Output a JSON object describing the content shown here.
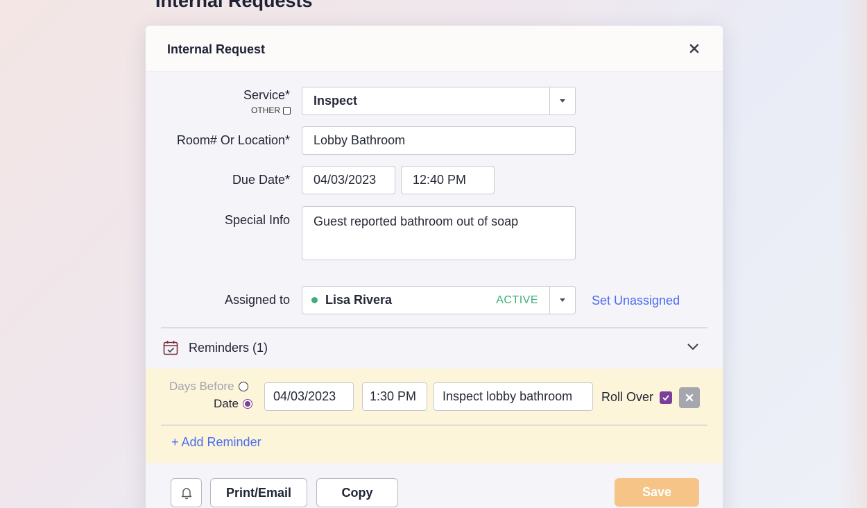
{
  "page": {
    "heading": "Internal Requests"
  },
  "modal": {
    "title": "Internal Request",
    "close_glyph": "✕"
  },
  "form": {
    "service": {
      "label": "Service*",
      "other_label": "OTHER",
      "value": "Inspect"
    },
    "location": {
      "label": "Room# Or Location*",
      "value": "Lobby Bathroom"
    },
    "due_date": {
      "label": "Due Date*",
      "date": "04/03/2023",
      "time": "12:40 PM"
    },
    "special_info": {
      "label": "Special Info",
      "value": "Guest reported bathroom out of soap"
    },
    "assigned": {
      "label": "Assigned to",
      "name": "Lisa Rivera",
      "status": "ACTIVE",
      "status_color": "#3fae7a",
      "set_unassigned": "Set Unassigned"
    }
  },
  "reminders": {
    "title": "Reminders (1)",
    "items": [
      {
        "days_before_label": "Days Before",
        "date_label": "Date",
        "mode": "Date",
        "date": "04/03/2023",
        "time": "1:30 PM",
        "text": "Inspect lobby bathroom",
        "roll_over_label": "Roll Over",
        "roll_over_checked": true
      }
    ],
    "add_label": "+ Add Reminder"
  },
  "footer": {
    "print_label": "Print/Email",
    "copy_label": "Copy",
    "save_label": "Save"
  },
  "colors": {
    "accent_link": "#4b6cf0",
    "checkbox_purple": "#7a3f9a",
    "save_orange": "#f6c486",
    "reminder_bg": "#fcf5d9"
  }
}
